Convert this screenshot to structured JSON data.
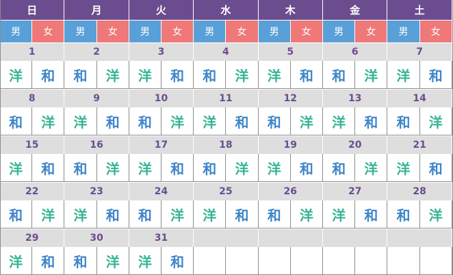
{
  "weekdays": [
    "日",
    "月",
    "火",
    "水",
    "木",
    "金",
    "土"
  ],
  "gender_labels": {
    "male": "男",
    "female": "女"
  },
  "weeks": [
    {
      "dates": [
        "1",
        "2",
        "3",
        "4",
        "5",
        "6",
        "7"
      ],
      "marks": [
        [
          "洋",
          "和"
        ],
        [
          "和",
          "洋"
        ],
        [
          "洋",
          "和"
        ],
        [
          "和",
          "洋"
        ],
        [
          "洋",
          "和"
        ],
        [
          "和",
          "洋"
        ],
        [
          "洋",
          "和"
        ]
      ]
    },
    {
      "dates": [
        "8",
        "9",
        "10",
        "11",
        "12",
        "13",
        "14"
      ],
      "marks": [
        [
          "和",
          "洋"
        ],
        [
          "洋",
          "和"
        ],
        [
          "和",
          "洋"
        ],
        [
          "洋",
          "和"
        ],
        [
          "和",
          "洋"
        ],
        [
          "洋",
          "和"
        ],
        [
          "和",
          "洋"
        ]
      ]
    },
    {
      "dates": [
        "15",
        "16",
        "17",
        "18",
        "19",
        "20",
        "21"
      ],
      "marks": [
        [
          "洋",
          "和"
        ],
        [
          "和",
          "洋"
        ],
        [
          "洋",
          "和"
        ],
        [
          "和",
          "洋"
        ],
        [
          "洋",
          "和"
        ],
        [
          "和",
          "洋"
        ],
        [
          "洋",
          "和"
        ]
      ]
    },
    {
      "dates": [
        "22",
        "23",
        "24",
        "25",
        "26",
        "27",
        "28"
      ],
      "marks": [
        [
          "和",
          "洋"
        ],
        [
          "洋",
          "和"
        ],
        [
          "和",
          "洋"
        ],
        [
          "洋",
          "和"
        ],
        [
          "和",
          "洋"
        ],
        [
          "洋",
          "和"
        ],
        [
          "和",
          "洋"
        ]
      ]
    },
    {
      "dates": [
        "29",
        "30",
        "31",
        "",
        "",
        "",
        ""
      ],
      "marks": [
        [
          "洋",
          "和"
        ],
        [
          "和",
          "洋"
        ],
        [
          "洋",
          "和"
        ],
        [
          "",
          ""
        ],
        [
          "",
          ""
        ],
        [
          "",
          ""
        ],
        [
          "",
          ""
        ]
      ]
    }
  ],
  "colors": {
    "header": "#6b4d8f",
    "male": "#5aa0d8",
    "female": "#ef7878",
    "date_band": "#dedede",
    "wa_text": "#3e86c8",
    "you_text": "#35b493"
  }
}
